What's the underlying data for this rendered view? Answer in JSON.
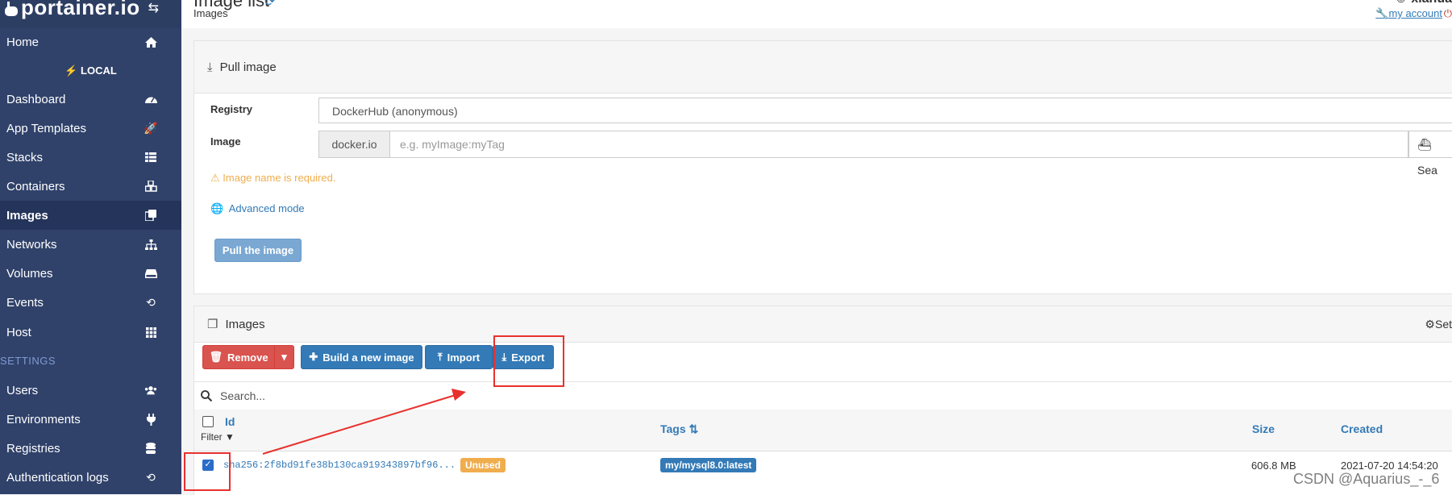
{
  "brand": {
    "name": "portainer.io",
    "logo_icon": "whale-icon",
    "toggle_icon": "exchange-icon"
  },
  "sidebar": {
    "env_label": "LOCAL",
    "settings_header": "SETTINGS",
    "items": [
      {
        "label": "Home",
        "icon": "home-icon"
      },
      {
        "label": "Dashboard",
        "icon": "tachometer-icon"
      },
      {
        "label": "App Templates",
        "icon": "rocket-icon"
      },
      {
        "label": "Stacks",
        "icon": "th-list-icon"
      },
      {
        "label": "Containers",
        "icon": "cubes-icon"
      },
      {
        "label": "Images",
        "icon": "clone-icon"
      },
      {
        "label": "Networks",
        "icon": "sitemap-icon"
      },
      {
        "label": "Volumes",
        "icon": "hdd-icon"
      },
      {
        "label": "Events",
        "icon": "history-icon"
      },
      {
        "label": "Host",
        "icon": "th-icon"
      },
      {
        "label": "Users",
        "icon": "users-icon"
      },
      {
        "label": "Environments",
        "icon": "plug-icon"
      },
      {
        "label": "Registries",
        "icon": "database-icon"
      },
      {
        "label": "Authentication logs",
        "icon": "history-icon"
      }
    ]
  },
  "header": {
    "title": "Image list",
    "breadcrumb": "Images",
    "user": "xiahua",
    "account_link": "my account"
  },
  "pull_panel": {
    "title": "Pull image",
    "registry_label": "Registry",
    "registry_value": "DockerHub (anonymous)",
    "image_label": "Image",
    "image_prefix": "docker.io",
    "image_placeholder": "e.g. myImage:myTag",
    "search_label": "Sea",
    "warning": "Image name is required.",
    "advanced_link": "Advanced mode",
    "pull_button": "Pull the image"
  },
  "images_panel": {
    "title": "Images",
    "settings_label": "Set",
    "remove_button": "Remove",
    "build_button": "Build a new image",
    "import_button": "Import",
    "export_button": "Export",
    "search_placeholder": "Search...",
    "columns": {
      "id": "Id",
      "filter": "Filter",
      "tags": "Tags",
      "size": "Size",
      "created": "Created"
    },
    "rows": [
      {
        "id": "sha256:2f8bd91fe38b130ca919343897bf96...",
        "badge": "Unused",
        "tag": "my/mysql8.0:latest",
        "size": "606.8 MB",
        "created": "2021-07-20 14:54:20",
        "selected": true
      }
    ]
  },
  "colors": {
    "sidebar": "#30426a",
    "primary": "#337ab7",
    "danger": "#d9534f",
    "warning": "#f0ad4e",
    "annotation": "#e8312e"
  },
  "watermark": "CSDN @Aquarius_-_6"
}
